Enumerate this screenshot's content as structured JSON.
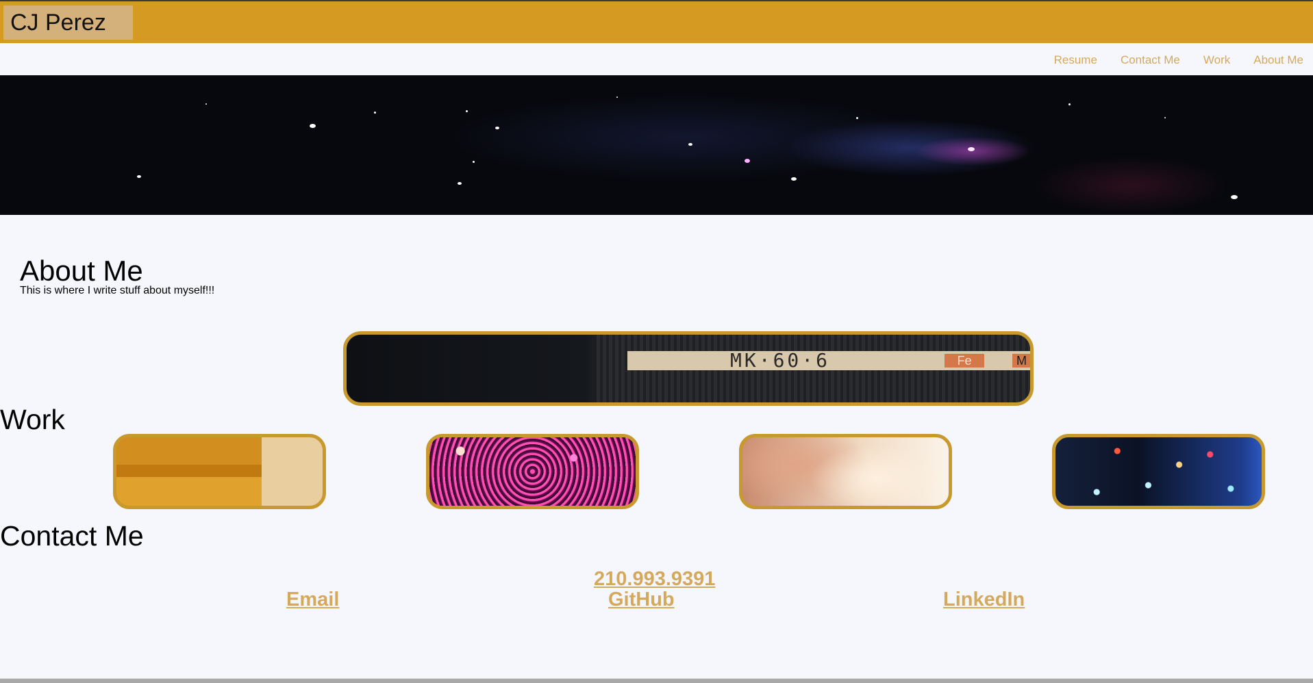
{
  "header": {
    "brand": "CJ Perez",
    "accent_color": "#d49a21",
    "brand_bg": "#d4b07b"
  },
  "nav": {
    "items": [
      {
        "label": "Resume"
      },
      {
        "label": "Contact Me"
      },
      {
        "label": "Work"
      },
      {
        "label": "About Me"
      }
    ],
    "link_color": "#d4a95c"
  },
  "hero": {
    "image": "starfield-banner"
  },
  "about": {
    "title": "About Me",
    "text": "This is where I write stuff about myself!!!"
  },
  "work": {
    "title": "Work",
    "featured": {
      "image": "cassette-tape-closeup",
      "label_text": "MK·60·6",
      "badge_1": "Fe",
      "badge_2": "M"
    },
    "cards": [
      {
        "image": "orange-rooftop-bird"
      },
      {
        "image": "pink-bokeh-lights"
      },
      {
        "image": "dust-explosion"
      },
      {
        "image": "hanging-light-bulbs"
      }
    ],
    "border_color": "#c8992d"
  },
  "contact": {
    "title": "Contact Me",
    "phone": "210.993.9391",
    "email": "Email",
    "github": "GitHub",
    "linkedin": "LinkedIn"
  }
}
